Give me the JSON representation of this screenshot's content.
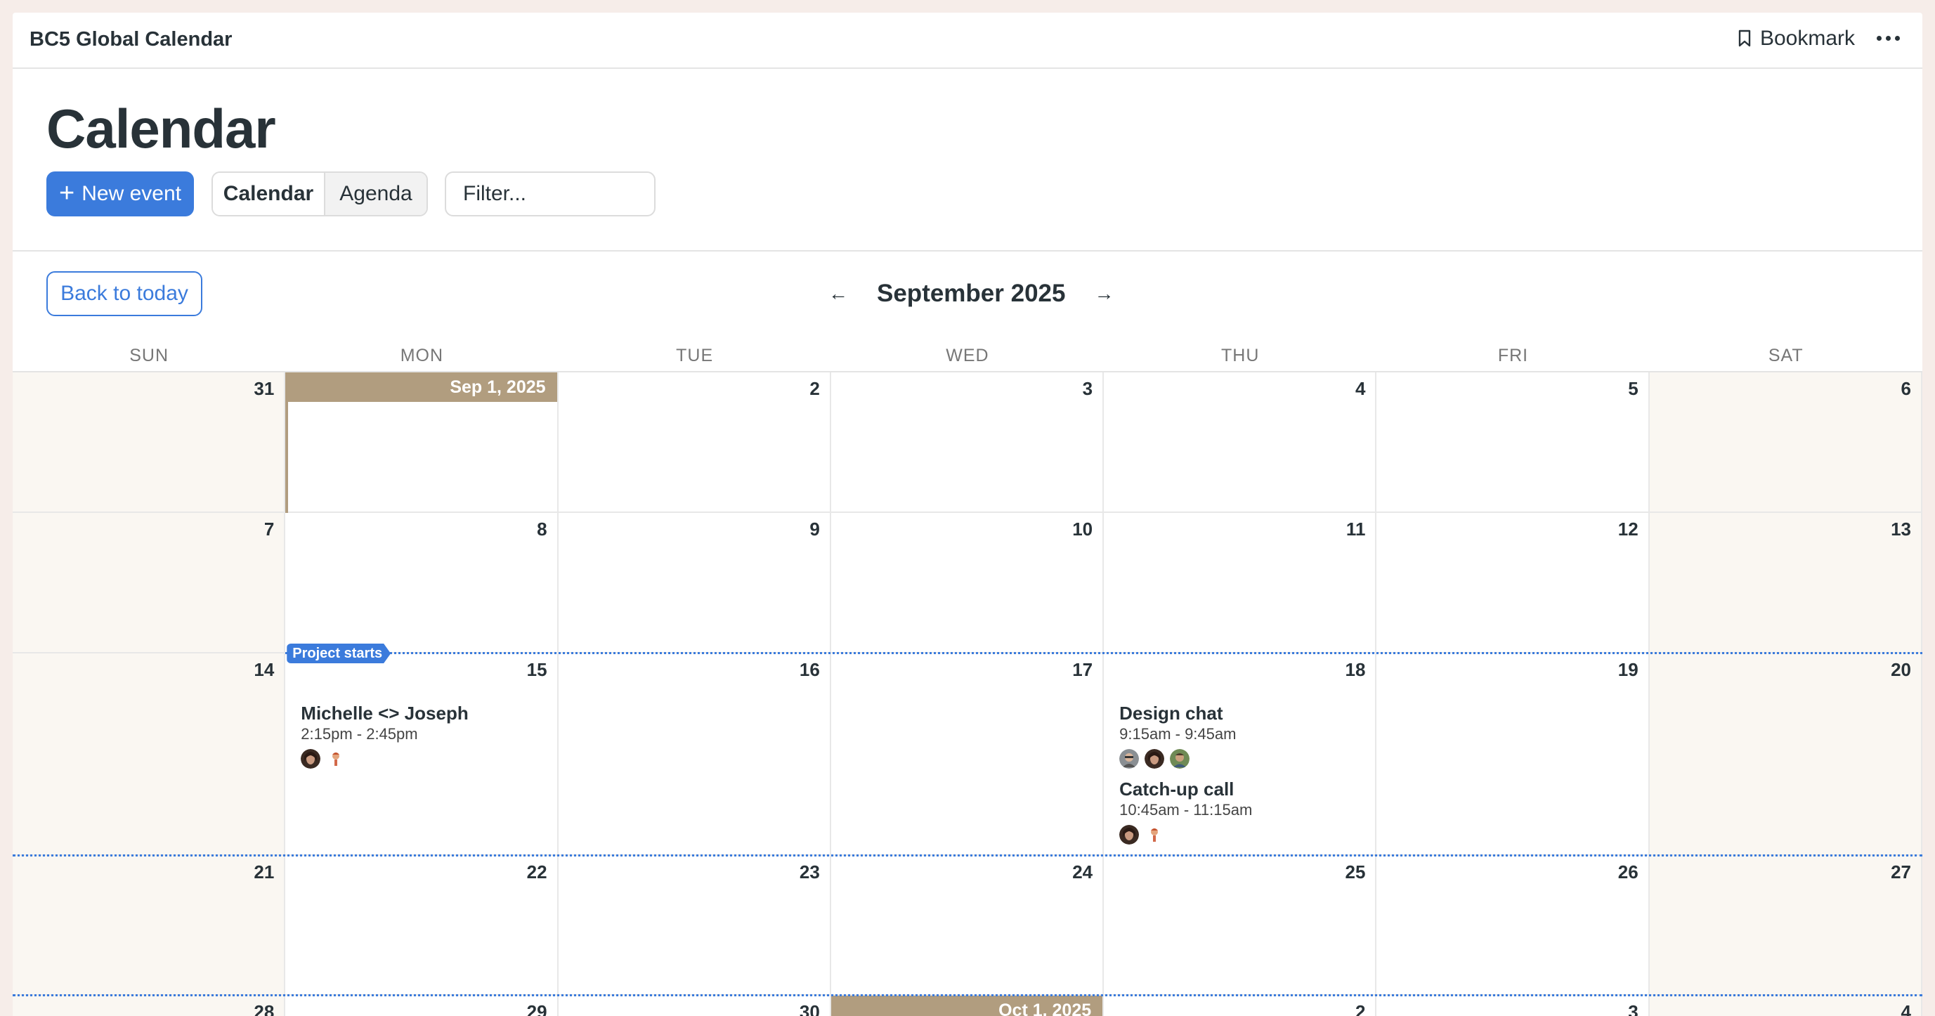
{
  "topbar": {
    "project_title": "BC5 Global Calendar",
    "bookmark_label": "Bookmark"
  },
  "header": {
    "page_title": "Calendar",
    "new_event_label": "New event",
    "view_tabs": [
      {
        "label": "Calendar",
        "active": true
      },
      {
        "label": "Agenda",
        "active": false
      }
    ],
    "filter_placeholder": "Filter..."
  },
  "nav": {
    "back_to_today_label": "Back to today",
    "month_label": "September 2025",
    "prev_arrow": "←",
    "next_arrow": "→"
  },
  "weekdays": [
    "SUN",
    "MON",
    "TUE",
    "WED",
    "THU",
    "FRI",
    "SAT"
  ],
  "weeks": [
    [
      {
        "day": "31"
      },
      {
        "day": "Sep 1, 2025",
        "month_start": true,
        "today": true
      },
      {
        "day": "2"
      },
      {
        "day": "3"
      },
      {
        "day": "4"
      },
      {
        "day": "5"
      },
      {
        "day": "6"
      }
    ],
    [
      {
        "day": "7"
      },
      {
        "day": "8"
      },
      {
        "day": "9"
      },
      {
        "day": "10"
      },
      {
        "day": "11"
      },
      {
        "day": "12"
      },
      {
        "day": "13"
      }
    ],
    [
      {
        "day": "14"
      },
      {
        "day": "15"
      },
      {
        "day": "16"
      },
      {
        "day": "17"
      },
      {
        "day": "18"
      },
      {
        "day": "19"
      },
      {
        "day": "20"
      }
    ],
    [
      {
        "day": "21"
      },
      {
        "day": "22"
      },
      {
        "day": "23"
      },
      {
        "day": "24"
      },
      {
        "day": "25"
      },
      {
        "day": "26"
      },
      {
        "day": "27"
      }
    ],
    [
      {
        "day": "28"
      },
      {
        "day": "29"
      },
      {
        "day": "30"
      },
      {
        "day": "Oct 1, 2025",
        "month_start": true
      },
      {
        "day": "2"
      },
      {
        "day": "3"
      },
      {
        "day": "4"
      }
    ]
  ],
  "multi_day_event": {
    "label": "Project starts"
  },
  "events": [
    {
      "title": "Michelle <> Joseph",
      "time": "2:15pm - 2:45pm",
      "avatars": [
        "avatar-woman",
        "avatar-man-red"
      ]
    },
    {
      "title": "Design chat",
      "time": "9:15am - 9:45am",
      "avatars": [
        "avatar-man-glasses",
        "avatar-woman",
        "avatar-man-green"
      ]
    },
    {
      "title": "Catch-up call",
      "time": "10:45am - 11:15am",
      "avatars": [
        "avatar-woman",
        "avatar-man-red"
      ]
    }
  ],
  "colors": {
    "accent": "#3b7bdc",
    "month_start_bg": "#b19d7f",
    "weekend_bg": "#faf7f2",
    "page_bg": "#f6ede9"
  }
}
